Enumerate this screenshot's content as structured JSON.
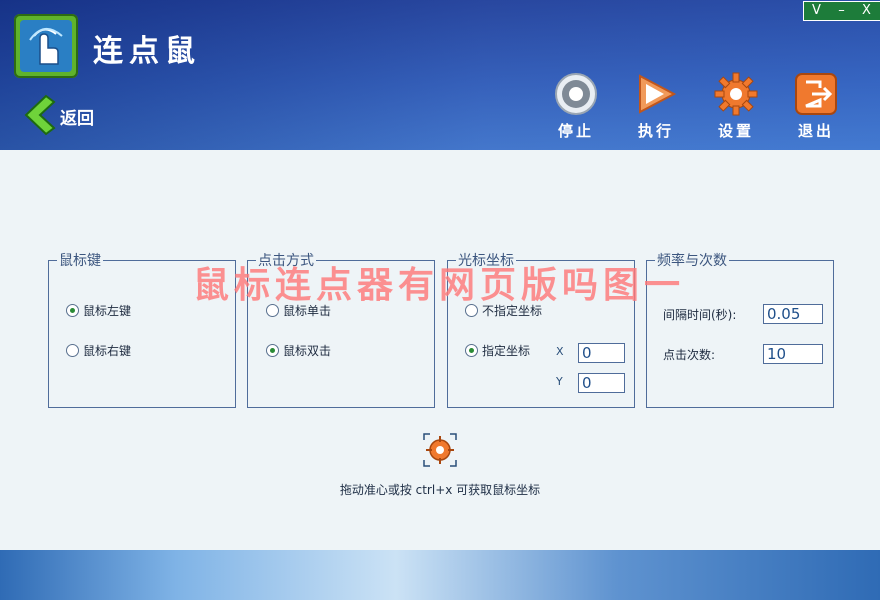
{
  "app": {
    "title": "连点鼠"
  },
  "window_controls": {
    "minimize_v": "V",
    "minimize": "–",
    "close": "X"
  },
  "nav": {
    "back_label": "返回"
  },
  "toolbar": {
    "stop": "停止",
    "run": "执行",
    "settings": "设置",
    "exit": "退出"
  },
  "groups": {
    "mouse_button": {
      "title": "鼠标键",
      "left": "鼠标左键",
      "right": "鼠标右键",
      "selected": "left"
    },
    "click_mode": {
      "title": "点击方式",
      "single": "鼠标单击",
      "double": "鼠标双击",
      "selected": "double"
    },
    "cursor_coord": {
      "title": "光标坐标",
      "unspecified": "不指定坐标",
      "specified": "指定坐标",
      "x_label": "X",
      "y_label": "Y",
      "x_value": "0",
      "y_value": "0",
      "selected": "specified"
    },
    "frequency": {
      "title": "频率与次数",
      "interval_label": "间隔时间(秒):",
      "interval_value": "0.05",
      "count_label": "点击次数:",
      "count_value": "10"
    }
  },
  "hint": "拖动准心或按 ctrl+x 可获取鼠标坐标",
  "watermark": "鼠标连点器有网页版吗图一",
  "icons": {
    "app": "hand-click-icon",
    "back": "chevron-left-icon",
    "stop": "stop-icon",
    "run": "play-icon",
    "settings": "gear-icon",
    "exit": "exit-icon",
    "crosshair": "crosshair-icon"
  },
  "colors": {
    "header": "#1d3d9a",
    "accent_green": "#2a8b35",
    "body_bg": "#eef4f7",
    "group_border": "#4f6c9a",
    "watermark": "#ff7a7a"
  }
}
